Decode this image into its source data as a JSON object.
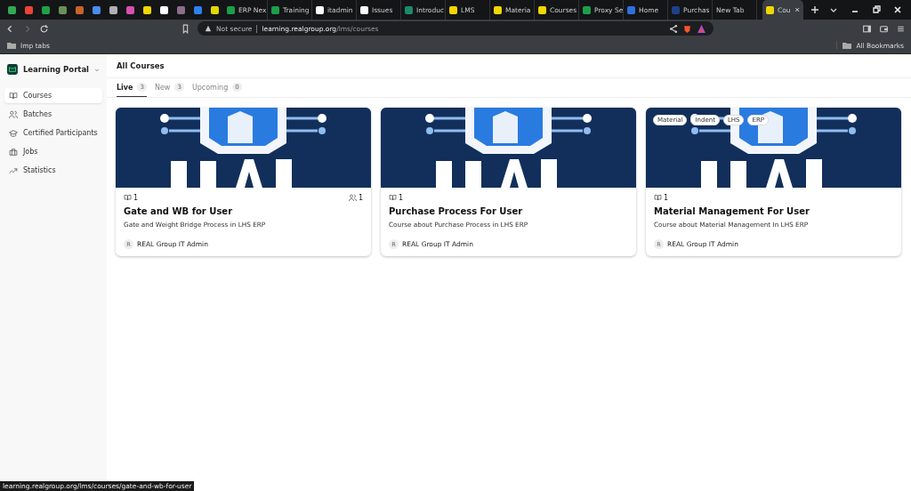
{
  "browser": {
    "tabs": [
      {
        "kind": "icon",
        "color": "#34a853",
        "selected": false
      },
      {
        "kind": "icon",
        "color": "#ea4335",
        "selected": false
      },
      {
        "kind": "icon",
        "color": "#22a045",
        "selected": false
      },
      {
        "kind": "icon",
        "color": "#6b8f5a",
        "selected": false
      },
      {
        "kind": "icon",
        "color": "#c8642a",
        "selected": false
      },
      {
        "kind": "icon",
        "color": "#4a8cf0",
        "selected": false
      },
      {
        "kind": "icon",
        "color": "#b0b0b0",
        "selected": false
      },
      {
        "kind": "icon",
        "color": "#d94fb0",
        "selected": false
      },
      {
        "kind": "icon",
        "color": "#f2d600",
        "selected": false
      },
      {
        "kind": "icon",
        "color": "#ffffff",
        "selected": false
      },
      {
        "kind": "icon",
        "color": "#8a6f8a",
        "selected": false
      },
      {
        "kind": "icon",
        "color": "#2f80ed",
        "selected": false
      },
      {
        "kind": "icon",
        "color": "#e6d600",
        "selected": false
      },
      {
        "kind": "text",
        "title": "ERP Nex",
        "color": "#1e9e4a",
        "selected": false
      },
      {
        "kind": "text",
        "title": "Training",
        "color": "#1e9e4a",
        "selected": false
      },
      {
        "kind": "text",
        "title": "itadmin",
        "color": "#ffffff",
        "selected": false
      },
      {
        "kind": "text",
        "title": "Issues",
        "color": "#ffffff",
        "selected": false
      },
      {
        "kind": "text",
        "title": "Introduc",
        "color": "#1c8a6a",
        "selected": false
      },
      {
        "kind": "text",
        "title": "LMS",
        "color": "#f2d600",
        "selected": false
      },
      {
        "kind": "text",
        "title": "Materia",
        "color": "#f2d600",
        "selected": false
      },
      {
        "kind": "text",
        "title": "Courses",
        "color": "#f2d600",
        "selected": false
      },
      {
        "kind": "text",
        "title": "Proxy Se",
        "color": "#1e9e4a",
        "selected": false
      },
      {
        "kind": "text",
        "title": "Home",
        "color": "#2f6fe0",
        "selected": false
      },
      {
        "kind": "text",
        "title": "Purchas",
        "color": "#1f3f8a",
        "selected": false
      },
      {
        "kind": "text",
        "title": "New Tab",
        "selected": false
      },
      {
        "kind": "text",
        "title": "Cou",
        "color": "#f2d600",
        "selected": true
      }
    ],
    "address": {
      "security": "Not secure",
      "host": "learning.realgroup.org",
      "path": "/lms/courses"
    },
    "bookmarks": {
      "left": "Imp tabs",
      "right": "All Bookmarks"
    }
  },
  "sidebar": {
    "brand": "Learning Portal",
    "items": [
      {
        "label": "Courses",
        "selected": true
      },
      {
        "label": "Batches",
        "selected": false
      },
      {
        "label": "Certified Participants",
        "selected": false
      },
      {
        "label": "Jobs",
        "selected": false
      },
      {
        "label": "Statistics",
        "selected": false
      }
    ]
  },
  "page": {
    "title": "All Courses",
    "tabs": [
      {
        "label": "Live",
        "count": "3",
        "selected": true
      },
      {
        "label": "New",
        "count": "3",
        "selected": false
      },
      {
        "label": "Upcoming",
        "count": "0",
        "selected": false
      }
    ]
  },
  "courses": [
    {
      "lessons": "1",
      "students": "1",
      "title": "Gate and WB for User",
      "description": "Gate and Weight Bridge Process in LHS ERP",
      "avatar": "R",
      "author": "REAL Group IT Admin"
    },
    {
      "lessons": "1",
      "title": "Purchase Process For User",
      "description": "Course about Purchase Process in LHS ERP",
      "avatar": "R",
      "author": "REAL Group IT Admin"
    },
    {
      "lessons": "1",
      "title": "Material Management For User",
      "description": "Course about Material Management In LHS ERP",
      "avatar": "R",
      "author": "REAL Group IT Admin",
      "tags": [
        "Material",
        "Indent",
        "LHS",
        "ERP"
      ]
    }
  ],
  "status_url": "learning.realgroup.org/lms/courses/gate-and-wb-for-user"
}
